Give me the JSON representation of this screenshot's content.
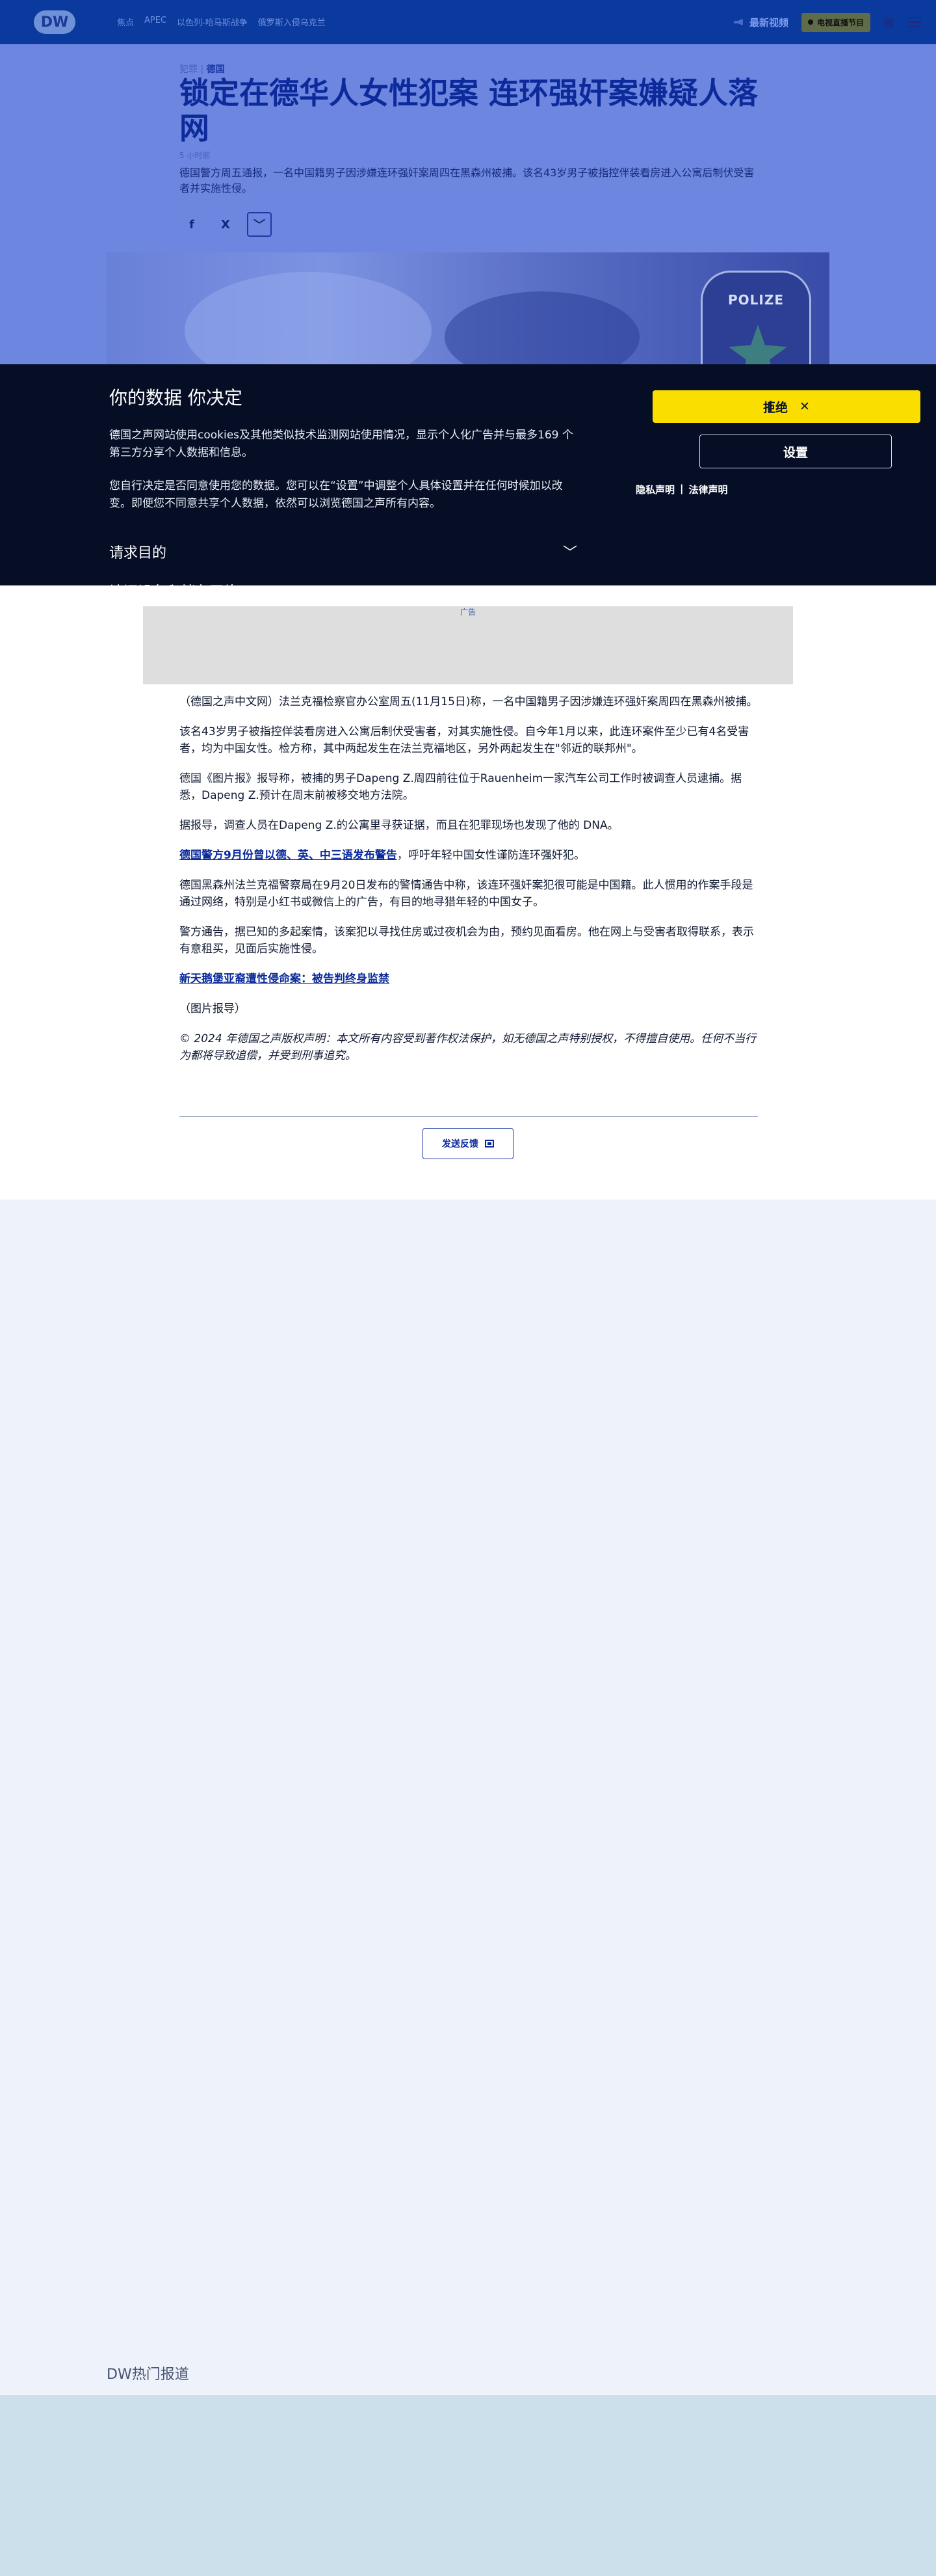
{
  "header": {
    "logo": "DW",
    "nav": [
      "焦点",
      "APEC",
      "以色列-哈马斯战争",
      "俄罗斯入侵乌克兰"
    ],
    "live_label": "最新视频",
    "tv_label": "电视直播节目"
  },
  "article": {
    "category": "犯罪",
    "region": "德国",
    "title": "锁定在德华人女性犯案 连环强奸案嫌疑人落网",
    "time_ago": "5 小时前",
    "lead": "德国警方周五通报，一名中国籍男子因涉嫌连环强奸案周四在黑森州被捕。该名43岁男子被指控伴装看房进入公寓后制伏受害者并实施性侵。",
    "hero_badge": "POLIZE",
    "share": {
      "facebook": "f",
      "x": "X",
      "more": "﹀"
    }
  },
  "consent": {
    "title": "你的数据 你决定",
    "p1": "德国之声网站使用cookies及其他类似技术监测网站使用情况，显示个人化广告并与最多169 个第三方分享个人数据和信息。",
    "p2": "您自行决定是否同意使用您的数据。您可以在“设置”中调整个人具体设置并在任何时候加以改变。即便您不同意共享个人数据，依然可以浏览德国之声所有内容。",
    "purpose_label": "请求目的",
    "chevron": "﹀",
    "reject_label": "拒绝",
    "reject_close": "✕",
    "settings_label": "设置",
    "privacy_label": "隐私声明",
    "separator": "|",
    "legal_label": "法律声明",
    "cut_text": "访问设备和储存网络"
  },
  "ad": {
    "label": "广告"
  },
  "body": {
    "p1": "（德国之声中文网）法兰克福检察官办公室周五(11月15日)称，一名中国籍男子因涉嫌连环强奸案周四在黑森州被捕。",
    "p2": "该名43岁男子被指控佯装看房进入公寓后制伏受害者，对其实施性侵。自今年1月以来，此连环案件至少已有4名受害者，均为中国女性。检方称，其中两起发生在法兰克福地区，另外两起发生在\"邻近的联邦州\"。",
    "p3": "德国《图片报》报导称，被捕的男子Dapeng Z.周四前往位于Rauenheim一家汽车公司工作时被调查人员逮捕。据悉，Dapeng Z.预计在周末前被移交地方法院。",
    "p4": "据报导，调查人员在Dapeng Z.的公寓里寻获证据，而且在犯罪现场也发现了他的 DNA。",
    "p5_link": "德国警方9月份曾以德、英、中三语发布警告",
    "p5_rest": "，呼吁年轻中国女性谨防连环强奸犯。",
    "p6": "德国黑森州法兰克福警察局在9月20日发布的警情通告中称，该连环强奸案犯很可能是中国籍。此人惯用的作案手段是通过网络，特别是小红书或微信上的广告，有目的地寻猎年轻的中国女子。",
    "p7": "警方通告，据已知的多起案情，该案犯以寻找住房或过夜机会为由，预约见面看房。他在网上与受害者取得联系，表示有意租买，见面后实施性侵。",
    "p8_link": "新天鹅堡亚裔遭性侵命案：被告判终身监禁",
    "p9": "（图片报导）",
    "copyright": "© 2024 年德国之声版权声明：本文所有内容受到著作权法保护，如无德国之声特别授权，不得擅自使用。任何不当行为都将导致追偿，并受到刑事追究。",
    "feedback_label": "发送反馈"
  },
  "hot_label": "DW热门报道"
}
